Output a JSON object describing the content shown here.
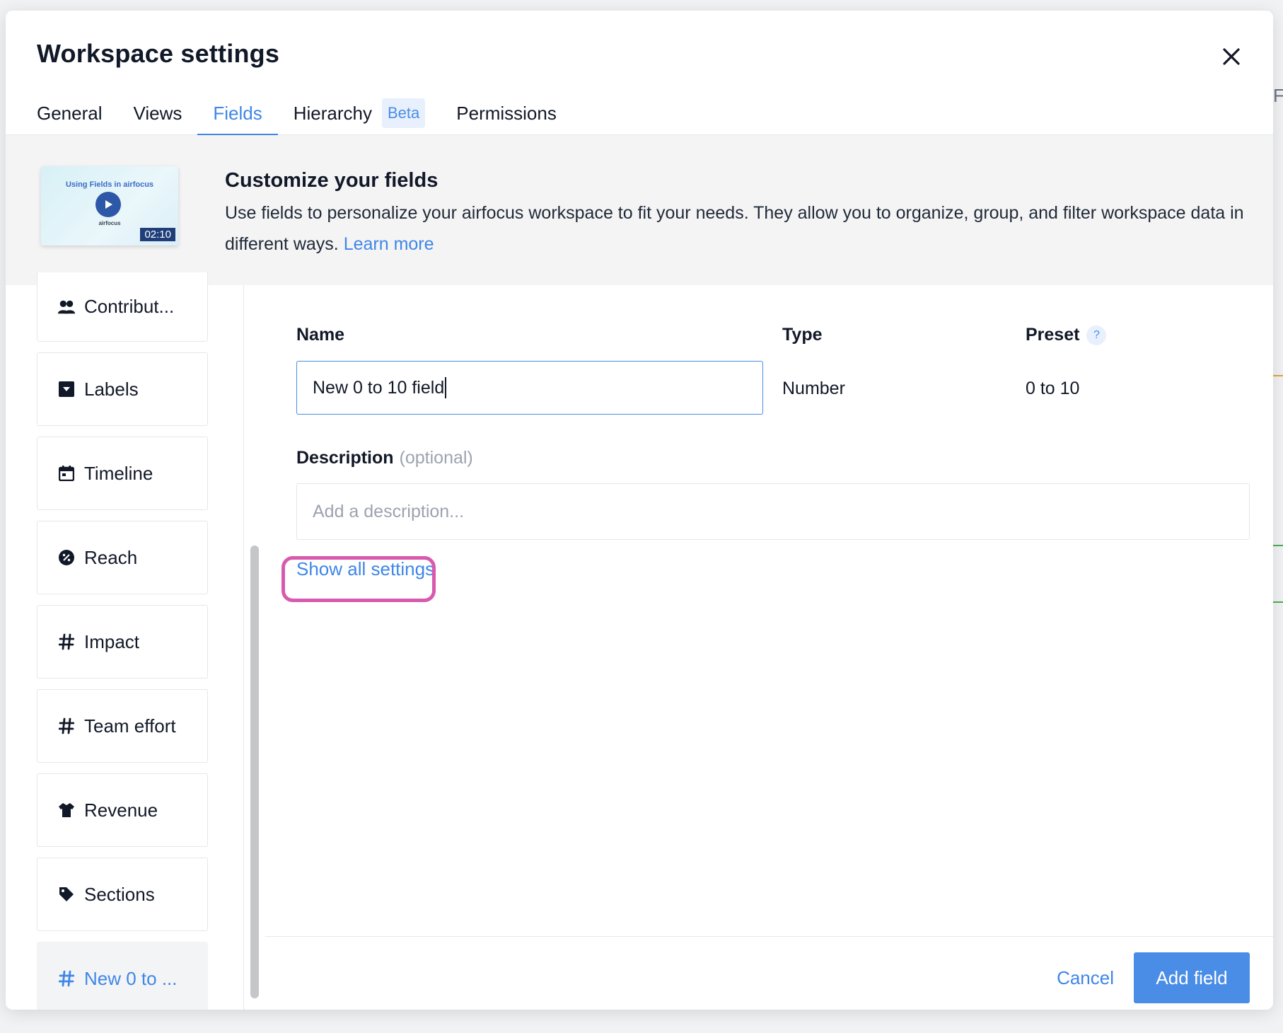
{
  "modal": {
    "title": "Workspace settings",
    "close_icon": "close-icon"
  },
  "tabs": [
    {
      "label": "General"
    },
    {
      "label": "Views"
    },
    {
      "label": "Fields",
      "active": true
    },
    {
      "label": "Hierarchy",
      "badge": "Beta"
    },
    {
      "label": "Permissions"
    }
  ],
  "banner": {
    "title": "Customize your fields",
    "text": "Use fields to personalize your airfocus workspace to fit your needs. They allow you to organize, group, and filter workspace data in different ways.",
    "link": "Learn more",
    "video": {
      "title": "Using Fields in airfocus",
      "brand": "airfocus",
      "duration": "02:10"
    }
  },
  "sidebar": {
    "items": [
      {
        "label": "Contribut...",
        "icon": "users-icon"
      },
      {
        "label": "Labels",
        "icon": "dropdown-icon"
      },
      {
        "label": "Timeline",
        "icon": "calendar-icon"
      },
      {
        "label": "Reach",
        "icon": "percent-icon"
      },
      {
        "label": "Impact",
        "icon": "hash-icon"
      },
      {
        "label": "Team effort",
        "icon": "hash-icon"
      },
      {
        "label": "Revenue",
        "icon": "shirt-icon"
      },
      {
        "label": "Sections",
        "icon": "tag-icon"
      },
      {
        "label": "New 0 to ...",
        "icon": "hash-icon",
        "active": true
      }
    ]
  },
  "form": {
    "name_label": "Name",
    "name_value": "New 0 to 10 field",
    "type_label": "Type",
    "type_value": "Number",
    "preset_label": "Preset",
    "preset_help": "?",
    "preset_value": "0 to 10",
    "description_label": "Description",
    "description_optional": "(optional)",
    "description_placeholder": "Add a description...",
    "show_all_settings": "Show all settings"
  },
  "footer": {
    "cancel": "Cancel",
    "add": "Add field"
  },
  "colors": {
    "accent": "#3f86e8",
    "primary_button": "#4a8de6",
    "highlight": "#d85aae"
  }
}
